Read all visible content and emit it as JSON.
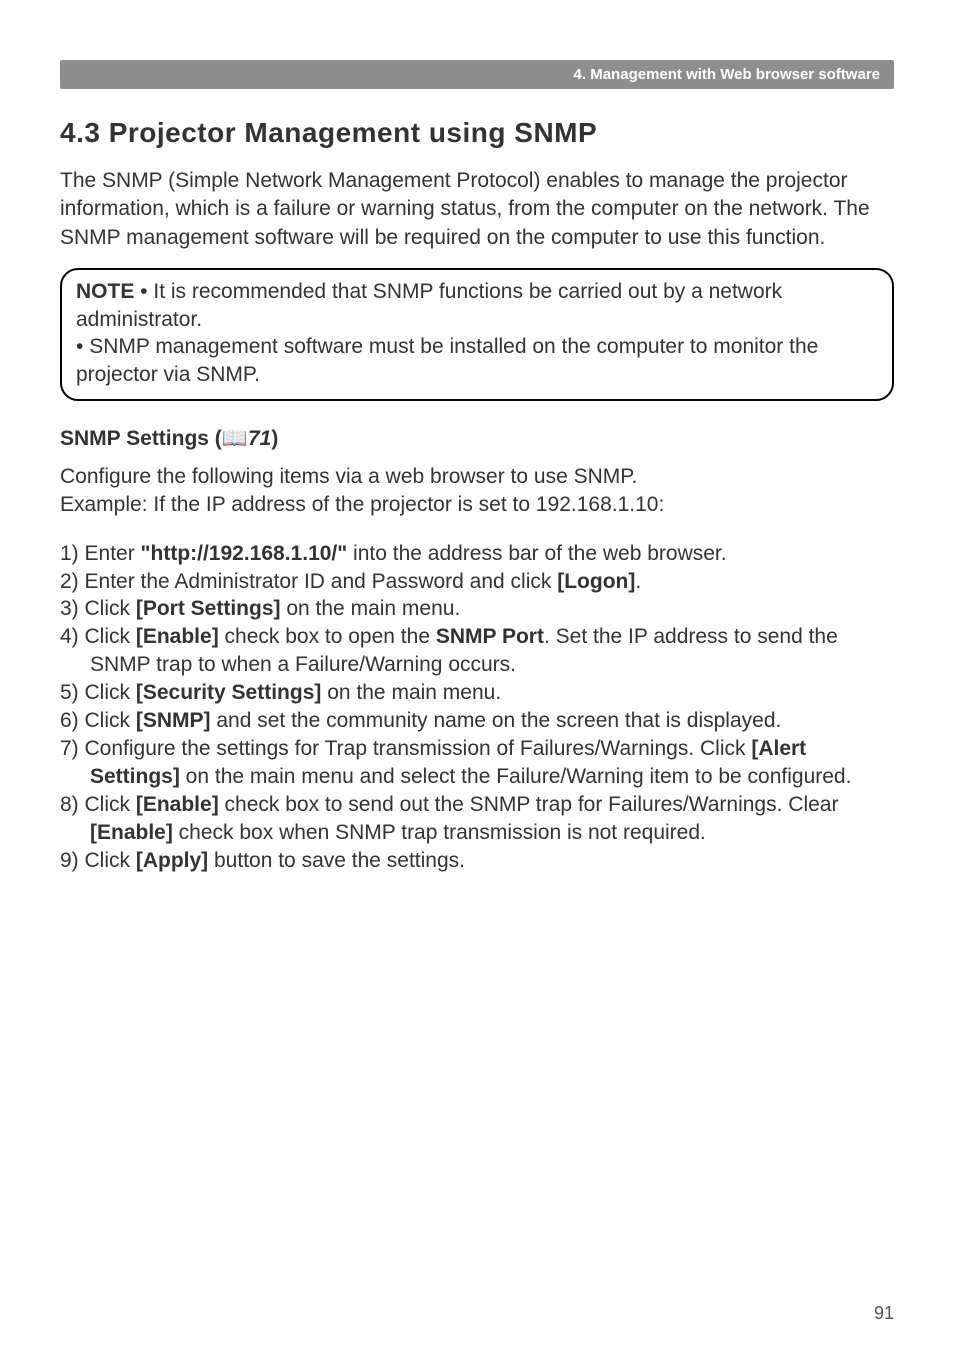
{
  "header": {
    "chapter_title": "4. Management with Web browser software"
  },
  "section": {
    "title": "4.3 Projector Management using SNMP",
    "intro": "The SNMP (Simple Network Management Protocol) enables to manage the projector information, which is a failure or warning status, from the computer on the network. The SNMP management software will be required on the computer to use this function."
  },
  "note": {
    "label": "NOTE",
    "line1_prefix": "  • ",
    "line1": "It is recommended that SNMP functions be carried out by a network administrator.",
    "line2_prefix": "• ",
    "line2": "SNMP management software must be installed on the computer to monitor the projector via SNMP."
  },
  "subsection": {
    "title_prefix": "SNMP Settings (",
    "ref_num": "71",
    "title_suffix": ")",
    "intro_line1": "Configure the following items via a web browser to use SNMP.",
    "intro_line2": "Example: If the IP address of the projector is set to 192.168.1.10:"
  },
  "steps": {
    "s1_pre": "1) Enter ",
    "s1_bold": "\"http://192.168.1.10/\"",
    "s1_post": " into the address bar of the web browser.",
    "s2_pre": "2) Enter the Administrator ID and Password and click ",
    "s2_bold": "[Logon]",
    "s2_post": ".",
    "s3_pre": "3) Click ",
    "s3_bold": "[Port Settings]",
    "s3_post": " on the main menu.",
    "s4_pre": "4) Click ",
    "s4_bold1": "[Enable]",
    "s4_mid": " check box to open the ",
    "s4_bold2": "SNMP Port",
    "s4_post": ". Set the IP address to send the SNMP trap to when a Failure/Warning occurs.",
    "s5_pre": "5) Click ",
    "s5_bold": "[Security Settings]",
    "s5_post": " on the main menu.",
    "s6_pre": "6) Click ",
    "s6_bold": "[SNMP]",
    "s6_post": " and set the community name on the screen that is displayed.",
    "s7_pre": "7) Configure the settings for Trap transmission of Failures/Warnings. Click ",
    "s7_bold": "[Alert Settings]",
    "s7_post": " on the main menu and select the Failure/Warning item to be configured.",
    "s8_pre": "8) Click ",
    "s8_bold1": "[Enable]",
    "s8_mid": " check box to send out the SNMP trap for Failures/Warnings. Clear ",
    "s8_bold2": "[Enable]",
    "s8_post": " check box when SNMP trap transmission is not required.",
    "s9_pre": "9) Click ",
    "s9_bold": "[Apply]",
    "s9_post": " button to save the settings."
  },
  "page_number": "91"
}
